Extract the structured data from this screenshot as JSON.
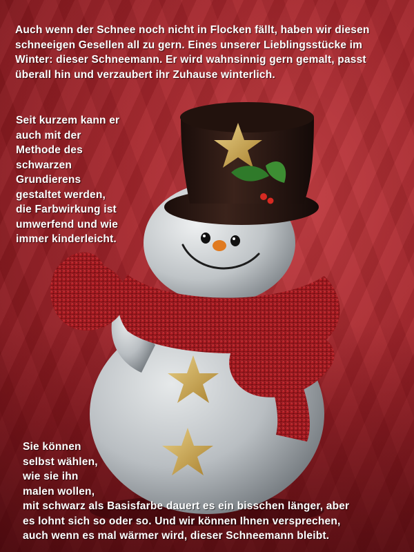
{
  "text": {
    "intro": "Auch wenn der Schnee noch nicht in Flocken fällt, haben wir diesen schneeigen Gesellen all zu gern. Eines unserer Lieblingsstücke im Winter: dieser Schneemann. Er wird wahnsinnig gern gemalt, passt überall hin und verzaubert ihr Zuhause winterlich.",
    "method_lines": [
      "Seit kurzem kann er",
      "auch mit der",
      "Methode des",
      "schwarzen",
      "Grundierens",
      "gestaltet werden,",
      "die Farbwirkung ist",
      "umwerfend und wie",
      "immer kinderleicht."
    ],
    "closing_lines": [
      "Sie können",
      "selbst wählen,",
      "wie sie ihn",
      "malen wollen,",
      "mit schwarz als Basisfarbe dauert es ein bisschen länger, aber",
      "es lohnt sich so oder so.  Und wir können Ihnen versprechen,",
      "auch wenn es mal wärmer wird, dieser Schneemann bleibt."
    ]
  },
  "colors": {
    "background": "#a5262c",
    "snow_body": "#c9cdd0",
    "hat": "#2a1712",
    "scarf": "#b01c22",
    "star": "#c9a24a",
    "holly": "#2f7a2a",
    "text": "#ffffff"
  }
}
